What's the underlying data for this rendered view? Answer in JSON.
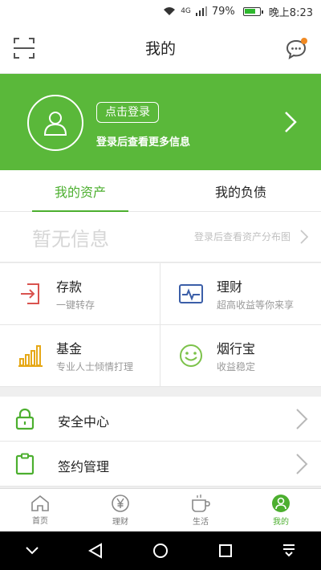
{
  "status_bar": {
    "signal_text": "4G",
    "battery_text": "79%",
    "battery_level": 0.79,
    "time": "晚上8:23"
  },
  "header": {
    "title": "我的",
    "scan_icon": "scan-icon",
    "message_icon": "message-icon"
  },
  "banner": {
    "login_button": "点击登录",
    "login_hint": "登录后查看更多信息"
  },
  "tabs": [
    {
      "label": "我的资产",
      "active": true
    },
    {
      "label": "我的负债",
      "active": false
    }
  ],
  "noinfo": {
    "title": "暂无信息",
    "hint": "登录后查看资产分布图"
  },
  "grid": [
    {
      "name": "存款",
      "desc": "一键转存",
      "icon": "deposit-icon"
    },
    {
      "name": "理财",
      "desc": "超高收益等你来享",
      "icon": "finance-icon"
    },
    {
      "name": "基金",
      "desc": "专业人士倾情打理",
      "icon": "fund-icon"
    },
    {
      "name": "烟行宝",
      "desc": "收益稳定",
      "icon": "smile-icon"
    }
  ],
  "list": [
    {
      "label": "安全中心",
      "icon": "lock-icon"
    },
    {
      "label": "签约管理",
      "icon": "clipboard-icon"
    }
  ],
  "tabbar": [
    {
      "label": "首页",
      "icon": "home-icon",
      "active": false
    },
    {
      "label": "理财",
      "icon": "yen-icon",
      "active": false
    },
    {
      "label": "生活",
      "icon": "cup-icon",
      "active": false
    },
    {
      "label": "我的",
      "icon": "user-icon",
      "active": true
    }
  ],
  "colors": {
    "brand": "#5ab83a",
    "accent": "#4caf2f",
    "badge": "#f08a24"
  }
}
